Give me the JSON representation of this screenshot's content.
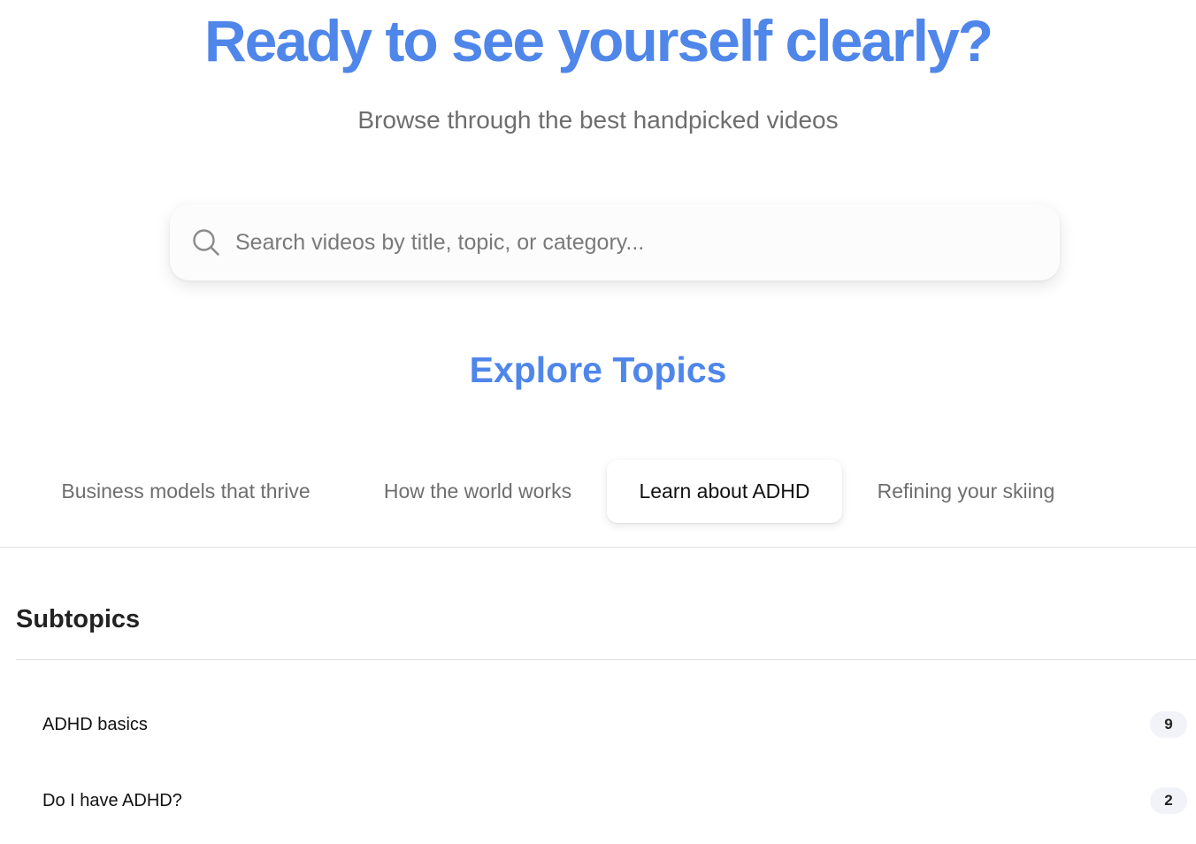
{
  "hero": {
    "title": "Ready to see yourself clearly?",
    "subtitle": "Browse through the best handpicked videos"
  },
  "search": {
    "icon": "search-icon",
    "placeholder": "Search videos by title, topic, or category...",
    "value": ""
  },
  "explore": {
    "title": "Explore Topics"
  },
  "tabs": [
    {
      "label": "Business models that thrive",
      "active": false
    },
    {
      "label": "How the world works",
      "active": false
    },
    {
      "label": "Learn about ADHD",
      "active": true
    },
    {
      "label": "Refining your skiing",
      "active": false
    }
  ],
  "subtopics": {
    "heading": "Subtopics",
    "items": [
      {
        "label": "ADHD basics",
        "count": "9"
      },
      {
        "label": "Do I have ADHD?",
        "count": "2"
      }
    ]
  },
  "colors": {
    "accent": "#4f86ea",
    "muted_text": "#6e6e6e",
    "badge_bg": "#f1f3f8"
  }
}
